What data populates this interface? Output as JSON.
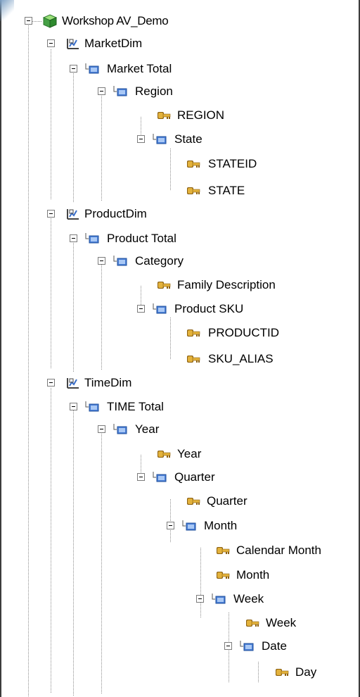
{
  "tree": {
    "root": "Workshop AV_Demo",
    "rows": [
      {
        "label": "Workshop AV_Demo",
        "icon": "cube-icon",
        "expanded": true
      },
      {
        "label": "MarketDim",
        "icon": "dimension-icon",
        "expanded": true
      },
      {
        "label": "Market Total",
        "icon": "level-icon",
        "expanded": true
      },
      {
        "label": "Region",
        "icon": "level-icon",
        "expanded": true
      },
      {
        "label": "REGION",
        "icon": "key-icon"
      },
      {
        "label": "State",
        "icon": "level-icon",
        "expanded": true
      },
      {
        "label": "STATEID",
        "icon": "key-icon"
      },
      {
        "label": "STATE",
        "icon": "key-icon"
      },
      {
        "label": "ProductDim",
        "icon": "dimension-icon",
        "expanded": true
      },
      {
        "label": "Product Total",
        "icon": "level-icon",
        "expanded": true
      },
      {
        "label": "Category",
        "icon": "level-icon",
        "expanded": true
      },
      {
        "label": "Family Description",
        "icon": "key-icon"
      },
      {
        "label": "Product SKU",
        "icon": "level-icon",
        "expanded": true
      },
      {
        "label": "PRODUCTID",
        "icon": "key-icon"
      },
      {
        "label": "SKU_ALIAS",
        "icon": "key-icon"
      },
      {
        "label": "TimeDim",
        "icon": "dimension-icon",
        "expanded": true
      },
      {
        "label": "TIME Total",
        "icon": "level-icon",
        "expanded": true
      },
      {
        "label": "Year",
        "icon": "level-icon",
        "expanded": true
      },
      {
        "label": "Year",
        "icon": "key-icon"
      },
      {
        "label": "Quarter",
        "icon": "level-icon",
        "expanded": true
      },
      {
        "label": "Quarter",
        "icon": "key-icon"
      },
      {
        "label": "Month",
        "icon": "level-icon",
        "expanded": true
      },
      {
        "label": "Calendar Month",
        "icon": "key-icon"
      },
      {
        "label": "Month",
        "icon": "key-icon"
      },
      {
        "label": "Week",
        "icon": "level-icon",
        "expanded": true
      },
      {
        "label": "Week",
        "icon": "key-icon"
      },
      {
        "label": "Date",
        "icon": "level-icon",
        "expanded": true
      },
      {
        "label": "Day",
        "icon": "key-icon"
      }
    ]
  },
  "colors": {
    "frame": "#3c3c3c",
    "connector": "#8e8e8e",
    "level_blue": "#4a7fd6",
    "key_gold": "#d9a520"
  }
}
